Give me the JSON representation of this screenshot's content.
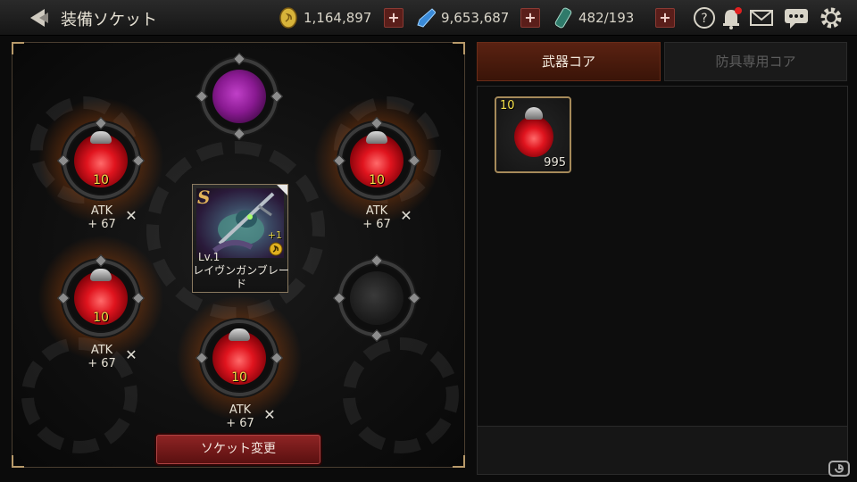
{
  "header": {
    "title": "装備ソケット",
    "gold": "1,164,897",
    "crystal": "9,653,687",
    "stamina": "482/193"
  },
  "tabs": {
    "weapon_core": "武器コア",
    "armor_core": "防具専用コア"
  },
  "sockets": [
    {
      "level": "10",
      "stat_name": "ATK",
      "stat_value": "+ 67"
    },
    {
      "level": "10",
      "stat_name": "ATK",
      "stat_value": "+ 67"
    },
    {
      "level": "10",
      "stat_name": "ATK",
      "stat_value": "+ 67"
    },
    {
      "level": "10",
      "stat_name": "ATK",
      "stat_value": "+ 67"
    }
  ],
  "weapon": {
    "rank": "S",
    "plus": "+1",
    "level": "Lv.1",
    "name": "レイヴンガンブレード"
  },
  "change_button": "ソケット変更",
  "inventory": [
    {
      "level": "10",
      "quantity": "995"
    }
  ],
  "colors": {
    "accent_red": "#8e2424",
    "level_yellow": "#f5e04a",
    "tab_active": "#5a2212"
  }
}
